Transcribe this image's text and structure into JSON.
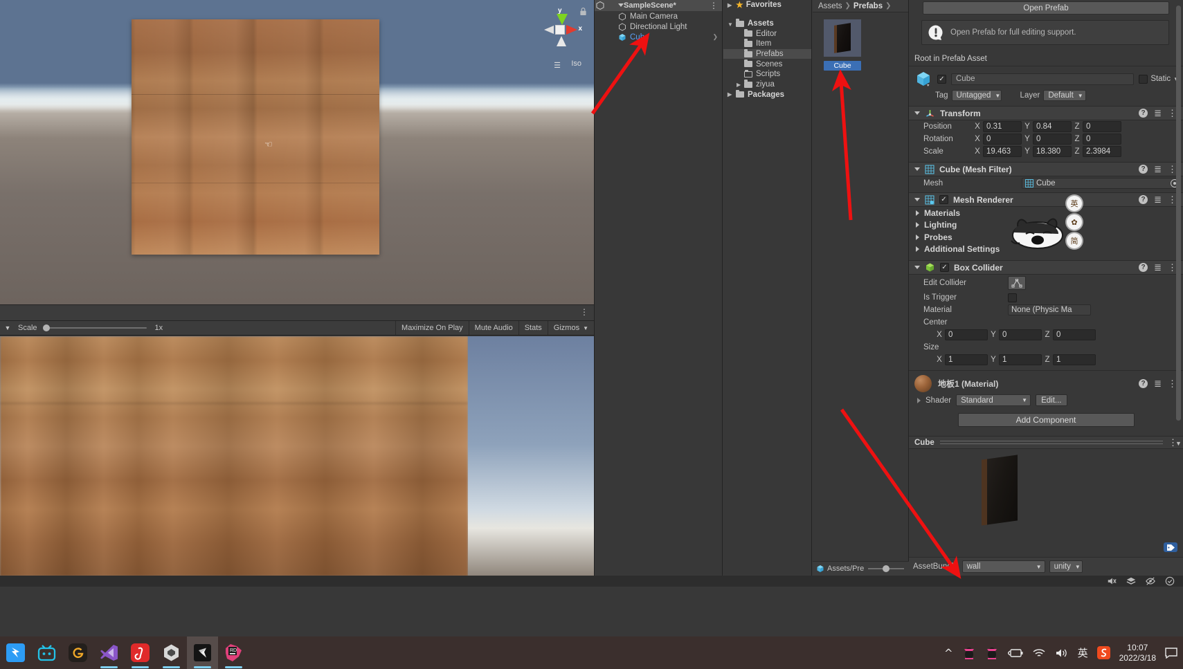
{
  "scene_view": {
    "gizmo": {
      "y_label": "y",
      "x_label": "x"
    },
    "view_mode": "Iso",
    "lock_icon": "lock-icon"
  },
  "game_view": {
    "scale_label": "Scale",
    "scale_value": "1x",
    "buttons": [
      "Maximize On Play",
      "Mute Audio",
      "Stats",
      "Gizmos"
    ]
  },
  "hierarchy": {
    "scene_name": "SampleScene*",
    "items": [
      {
        "label": "Main Camera",
        "icon": "gameobject-icon",
        "selected": false
      },
      {
        "label": "Directional Light",
        "icon": "gameobject-icon",
        "selected": false
      },
      {
        "label": "Cube",
        "icon": "prefab-cube-icon",
        "selected": true
      }
    ]
  },
  "project_tree": {
    "favorites": "Favorites",
    "items": [
      {
        "label": "Assets",
        "indent": 0,
        "bold": true,
        "expanded": true,
        "highlight": false,
        "arrow": "down"
      },
      {
        "label": "Editor",
        "indent": 1,
        "bold": false,
        "expanded": false,
        "highlight": false,
        "arrow": ""
      },
      {
        "label": "Item",
        "indent": 1,
        "bold": false,
        "expanded": false,
        "highlight": false,
        "arrow": ""
      },
      {
        "label": "Prefabs",
        "indent": 1,
        "bold": false,
        "expanded": false,
        "highlight": true,
        "arrow": ""
      },
      {
        "label": "Scenes",
        "indent": 1,
        "bold": false,
        "expanded": false,
        "highlight": false,
        "arrow": ""
      },
      {
        "label": "Scripts",
        "indent": 1,
        "bold": false,
        "expanded": false,
        "highlight": false,
        "arrow": ""
      },
      {
        "label": "ziyua",
        "indent": 1,
        "bold": false,
        "expanded": false,
        "highlight": false,
        "arrow": "right"
      },
      {
        "label": "Packages",
        "indent": 0,
        "bold": true,
        "expanded": false,
        "highlight": false,
        "arrow": "right"
      }
    ]
  },
  "project_content": {
    "breadcrumb": [
      "Assets",
      "Prefabs"
    ],
    "asset_name": "Cube",
    "status_path": "Assets/Pre"
  },
  "inspector": {
    "open_prefab_button": "Open Prefab",
    "help_message": "Open Prefab for full editing support.",
    "root_label": "Root in Prefab Asset",
    "gameobject": {
      "name": "Cube",
      "enabled": true,
      "static_label": "Static",
      "tag_label": "Tag",
      "tag_value": "Untagged",
      "layer_label": "Layer",
      "layer_value": "Default"
    },
    "transform": {
      "title": "Transform",
      "rows": [
        {
          "label": "Position",
          "x": "0.31",
          "y": "0.84",
          "z": "0"
        },
        {
          "label": "Rotation",
          "x": "0",
          "y": "0",
          "z": "0"
        },
        {
          "label": "Scale",
          "x": "19.463",
          "y": "18.380",
          "z": "2.3984"
        }
      ]
    },
    "mesh_filter": {
      "title": "Cube (Mesh Filter)",
      "mesh_label": "Mesh",
      "mesh_value": "Cube"
    },
    "mesh_renderer": {
      "title": "Mesh Renderer",
      "enabled": true,
      "foldouts": [
        "Materials",
        "Lighting",
        "Probes",
        "Additional Settings"
      ]
    },
    "box_collider": {
      "title": "Box Collider",
      "enabled": true,
      "edit_collider_label": "Edit Collider",
      "is_trigger_label": "Is Trigger",
      "is_trigger_value": false,
      "material_label": "Material",
      "material_value": "None (Physic Ma",
      "center_label": "Center",
      "center": {
        "x": "0",
        "y": "0",
        "z": "0"
      },
      "size_label": "Size",
      "size": {
        "x": "1",
        "y": "1",
        "z": "1"
      }
    },
    "material": {
      "name": "地板1",
      "suffix": "(Material)",
      "shader_label": "Shader",
      "shader_value": "Standard",
      "edit_button": "Edit..."
    },
    "add_component": "Add Component",
    "preview_title": "Cube",
    "assetbundle": {
      "label": "AssetBundle",
      "name_value": "wall",
      "variant_value": "unity"
    }
  },
  "taskbar": {
    "items": [
      {
        "name": "app-dingtalk",
        "glyph": "◥",
        "color": "#3aa0f5",
        "active": false,
        "underline": false
      },
      {
        "name": "app-bilibili",
        "glyph": "▱",
        "color": "#2ec0e8",
        "active": false,
        "underline": false
      },
      {
        "name": "app-gitee",
        "glyph": "G",
        "color": "#f0a828",
        "active": false,
        "underline": false
      },
      {
        "name": "app-visual-studio",
        "glyph": "✕",
        "color": "#a05fd0",
        "active": false,
        "underline": true
      },
      {
        "name": "app-netease-music",
        "glyph": "♪",
        "color": "#e02a2a",
        "active": false,
        "underline": true
      },
      {
        "name": "app-unity-hub",
        "glyph": "◈",
        "color": "#d8d8d8",
        "active": false,
        "underline": true
      },
      {
        "name": "app-unity-editor",
        "glyph": "◣",
        "color": "#1b1b1b",
        "active": true,
        "underline": true
      },
      {
        "name": "app-rider",
        "glyph": "RD",
        "color": "#e0407a",
        "active": false,
        "underline": true
      }
    ],
    "tray": {
      "chevron": "^",
      "ime_label": "英",
      "time": "10:07",
      "date": "2022/3/18"
    }
  }
}
